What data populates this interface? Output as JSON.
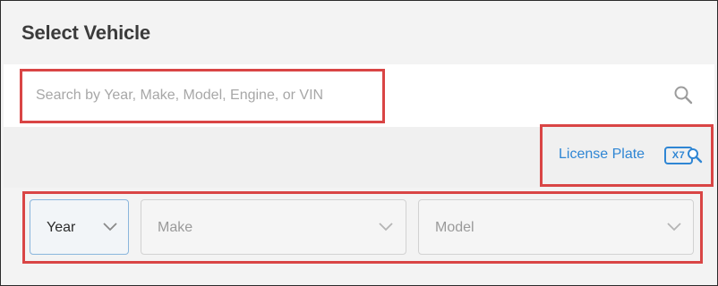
{
  "dialog": {
    "title": "Select Vehicle"
  },
  "search": {
    "placeholder": "Search by Year, Make, Model, Engine, or VIN",
    "icon": "search-icon"
  },
  "license_plate": {
    "label": "License Plate",
    "badge_text": "X7",
    "color": "#2f86d4"
  },
  "selects": {
    "year": {
      "label": "Year"
    },
    "make": {
      "label": "Make"
    },
    "model": {
      "label": "Model"
    }
  },
  "colors": {
    "highlight": "#d94545",
    "link": "#2f86d4"
  }
}
